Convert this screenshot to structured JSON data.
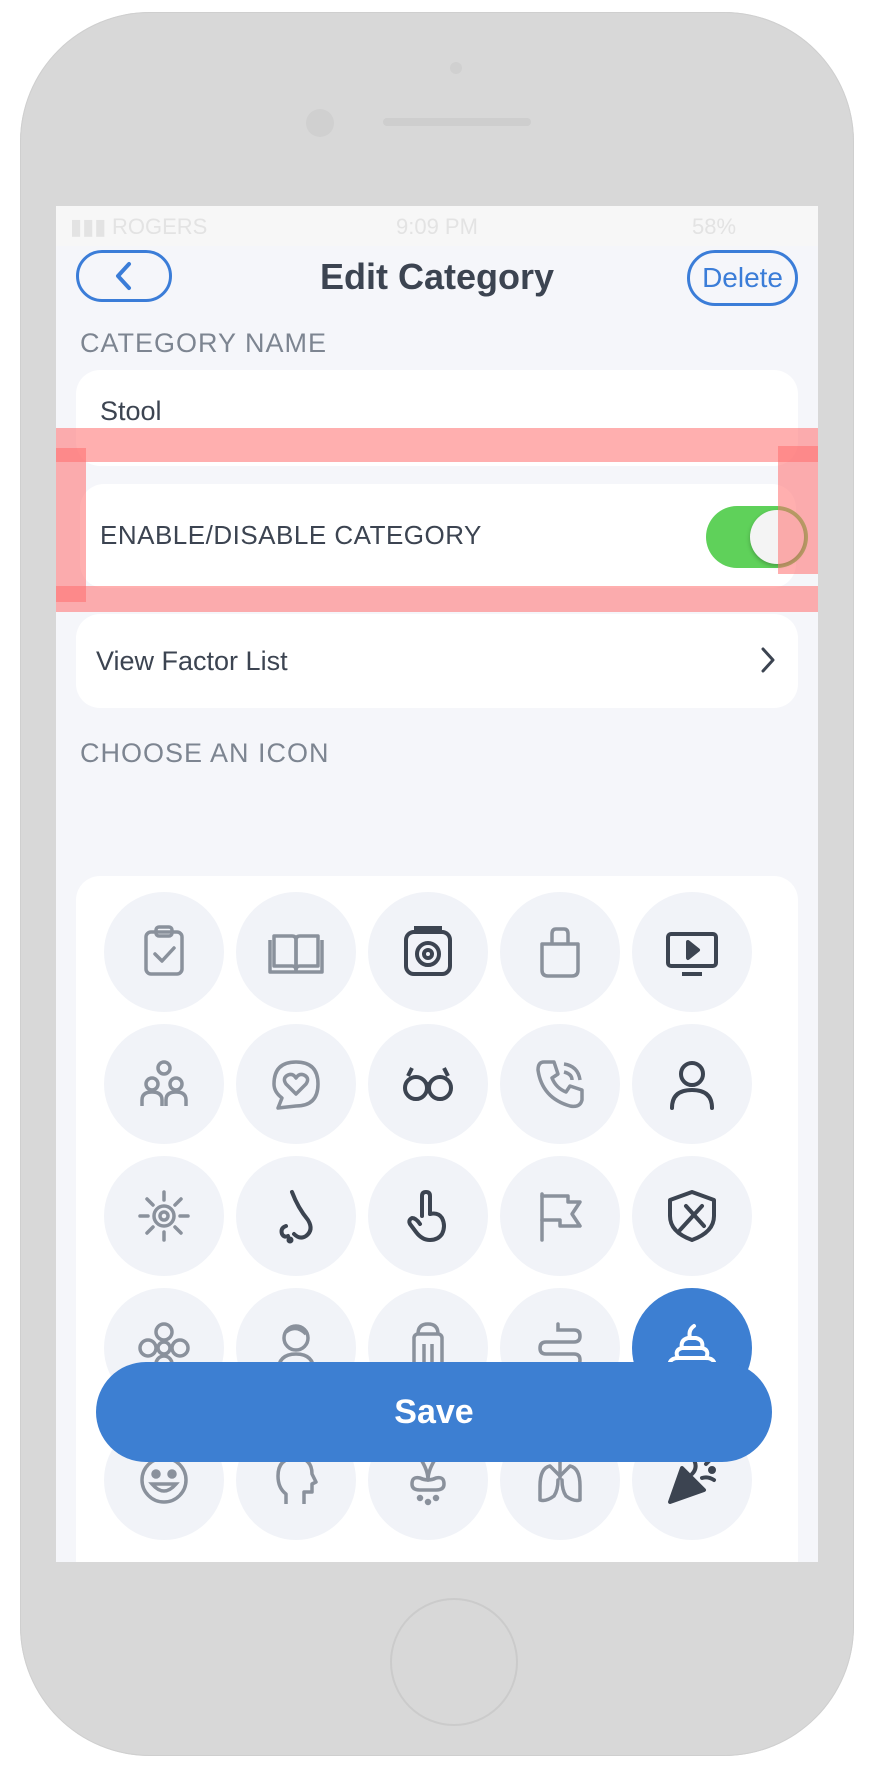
{
  "status_bar": {
    "carrier": "ROGERS",
    "time": "9:09 PM",
    "battery": "58%"
  },
  "header": {
    "title": "Edit Category",
    "back_icon": "chevron-left-icon",
    "delete_label": "Delete"
  },
  "category_name": {
    "label": "CATEGORY NAME",
    "value": "Stool"
  },
  "toggle_row": {
    "label": "ENABLE/DISABLE CATEGORY",
    "enabled": true,
    "on_color": "#5fd15a"
  },
  "factor_row": {
    "label": "View Factor List",
    "chevron_icon": "chevron-right-icon"
  },
  "icon_section": {
    "label": "CHOOSE AN ICON"
  },
  "icons": [
    "clipboard-check-icon",
    "open-book-icon",
    "camera-icon",
    "shopping-bag-icon",
    "tv-play-icon",
    "people-icon",
    "heart-chat-icon",
    "sunglasses-icon",
    "phone-call-icon",
    "user-icon",
    "sun-icon",
    "nose-icon",
    "pointing-hand-icon",
    "flag-icon",
    "shield-tools-icon",
    "flower-icon",
    "woman-icon",
    "salt-shaker-icon",
    "intestine-icon",
    "poop-icon",
    "smiley-icon",
    "head-profile-icon",
    "sneeze-icon",
    "lungs-icon",
    "party-popper-icon"
  ],
  "selected_icon": "poop-icon",
  "accent_color": "#3d7fd2",
  "save_label": "Save"
}
